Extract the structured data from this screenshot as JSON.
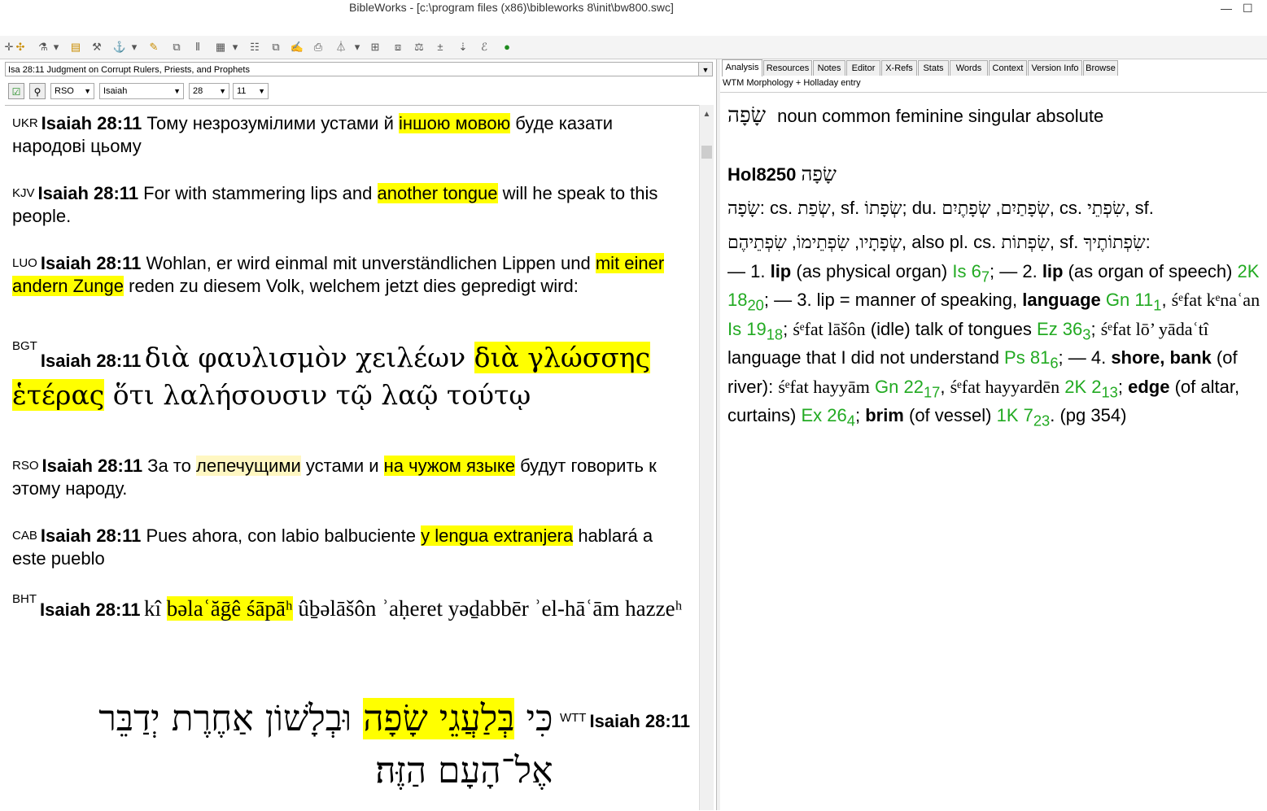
{
  "window": {
    "title": "BibleWorks - [c:\\program files (x86)\\bibleworks 8\\init\\bw800.swc]"
  },
  "reference_bar": {
    "value": "Isa 28:11 Judgment on Corrupt Rulers, Priests, and Prophets"
  },
  "nav": {
    "version": "RSO",
    "book": "Isaiah",
    "chapter": "28",
    "verse": "11"
  },
  "verses": [
    {
      "version": "UKR",
      "ref": "Isaiah 28:11",
      "pre": " Тому незрозумілими устами й ",
      "hl": "іншою мовою",
      "post": " буде казати народові цьому"
    },
    {
      "version": "KJV",
      "ref": "Isaiah 28:11",
      "pre": " For with stammering lips and ",
      "hl": "another tongue",
      "post": " will he speak to this people."
    },
    {
      "version": "LUO",
      "ref": "Isaiah 28:11",
      "pre": " Wohlan, er wird einmal mit unverständlichen Lippen und ",
      "hl": "mit einer andern Zunge",
      "post": " reden zu diesem Volk, welchem jetzt dies gepredigt wird:"
    },
    {
      "version": "BGT",
      "ref": "Isaiah 28:11",
      "pre": "διὰ φαυλισμὸν χειλέων ",
      "hl": "διὰ γλώσσης ἑτέρας",
      "post": " ὅτι λαλήσουσιν τῷ λαῷ τούτῳ"
    },
    {
      "version": "RSO",
      "ref": "Isaiah 28:11",
      "pre": " За то ",
      "hl_light": "лепечущими",
      "mid": " устами и ",
      "hl": "на чужом языке",
      "post": " будут говорить к этому народу."
    },
    {
      "version": "CAB",
      "ref": "Isaiah 28:11",
      "pre": " Pues ahora, con labio balbuciente ",
      "hl": "y lengua extranjera",
      "post": " hablará a este pueblo"
    },
    {
      "version": "BHT",
      "ref": "Isaiah 28:11",
      "pre": "kî ",
      "hl": "bəlaʿăḡê śāpāʰ",
      "post": " ûḇəlāšôn ʾaḥeret yəḏabbēr ʾel-hāʿām hazzeʰ"
    },
    {
      "version": "WTT",
      "ref": "Isaiah 28:11",
      "pre": "כִּי ",
      "hl": "בְּלַעֲגֵי שָׂפָה",
      "post": " וּבְלָשׁוֹן אַחֶרֶת יְדַבֵּר אֶל־הָעָם הַזֶּה׃"
    }
  ],
  "tabs": [
    "Analysis",
    "Resources",
    "Notes",
    "Editor",
    "X-Refs",
    "Stats",
    "Words",
    "Context",
    "Version Info",
    "Browse"
  ],
  "analysis": {
    "subtitle": "WTM Morphology + Holladay entry",
    "word": "שָׂפָה",
    "morph": "noun common feminine singular absolute",
    "entry_id": "Hol8250",
    "entry_word": "שָׂפָה"
  },
  "entry_parts": {
    "p1_heb": "שָׂפָה",
    "p1_txt": ": cs. ",
    "p1_heb2": "שְׂפַת",
    "p1_txt2": ", sf. ",
    "p1_heb3": "שְׂפָתוֹ",
    "p1_txt3": "; du. ",
    "p1_heb4": "שְׂפָתַיִם",
    "p1_txt4": ", ",
    "p1_heb5": "שְׂפָתֶיִם",
    "p1_txt5": ", cs. ",
    "p1_heb6": "שִׂפְתֵי",
    "p1_txt6": ", sf.",
    "p2_heb": "שְׂפָתָיו",
    "p2_txt": ", ",
    "p2_heb2": "שִׂפְתֵימוֹ",
    "p2_txt2": ", ",
    "p2_heb3": "שִׂפְתֵיהֶם",
    "p2_txt3": ", also pl. cs. ",
    "p2_heb4": "שִׂפְתוֹת",
    "p2_txt4": ", sf. ",
    "p2_heb5": "שִׂפְתוֹתֶיךָ",
    "p2_txt5": ":"
  }
}
